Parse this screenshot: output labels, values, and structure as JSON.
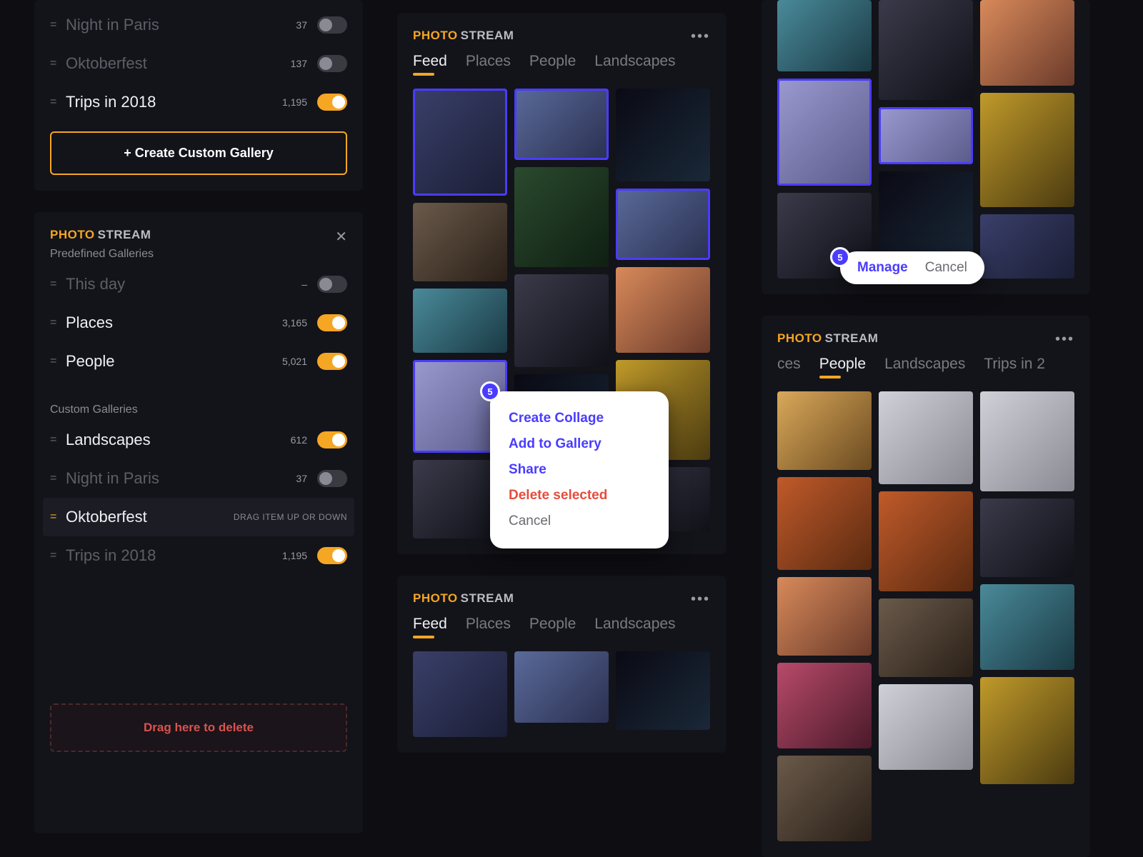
{
  "brand": {
    "photo": "PHOTO",
    "stream": "STREAM"
  },
  "left_top": {
    "items": [
      {
        "label": "Night in Paris",
        "count": "37",
        "on": false,
        "dim": true
      },
      {
        "label": "Oktoberfest",
        "count": "137",
        "on": false,
        "dim": true
      },
      {
        "label": "Trips in 2018",
        "count": "1,195",
        "on": true,
        "dim": false
      }
    ],
    "create_label": "+ Create Custom Gallery"
  },
  "left_panel": {
    "predefined_label": "Predefined Galleries",
    "predefined": [
      {
        "label": "This day",
        "count": "–",
        "on": false,
        "dim": true
      },
      {
        "label": "Places",
        "count": "3,165",
        "on": true,
        "dim": false
      },
      {
        "label": "People",
        "count": "5,021",
        "on": true,
        "dim": false
      }
    ],
    "custom_label": "Custom Galleries",
    "custom": [
      {
        "label": "Landscapes",
        "count": "612",
        "on": true,
        "dim": false
      },
      {
        "label": "Night in Paris",
        "count": "37",
        "on": false,
        "dim": true
      },
      {
        "label": "Oktoberfest",
        "dragging": true,
        "hint": "DRAG ITEM UP OR DOWN"
      },
      {
        "label": "Trips in 2018",
        "count": "1,195",
        "on": true,
        "dim": true
      }
    ],
    "drop_label": "Drag here to delete"
  },
  "mid_top": {
    "tabs": [
      "Feed",
      "Places",
      "People",
      "Landscapes"
    ],
    "active": 0,
    "popup_count": "5",
    "popup_items": [
      {
        "label": "Create Collage",
        "style": "blue"
      },
      {
        "label": "Add to Gallery",
        "style": "blue"
      },
      {
        "label": "Share",
        "style": "blue"
      },
      {
        "label": "Delete selected",
        "style": "red"
      },
      {
        "label": "Cancel",
        "style": "gray"
      }
    ]
  },
  "mid_bottom": {
    "tabs": [
      "Feed",
      "Places",
      "People",
      "Landscapes"
    ],
    "active": 0
  },
  "right_top": {
    "pill_count": "5",
    "pill_items": [
      {
        "label": "Manage",
        "style": "blue"
      },
      {
        "label": "Cancel",
        "style": "gray"
      }
    ]
  },
  "right_panel": {
    "tabs": [
      "ces",
      "People",
      "Landscapes",
      "Trips in 2"
    ],
    "active": 1
  }
}
